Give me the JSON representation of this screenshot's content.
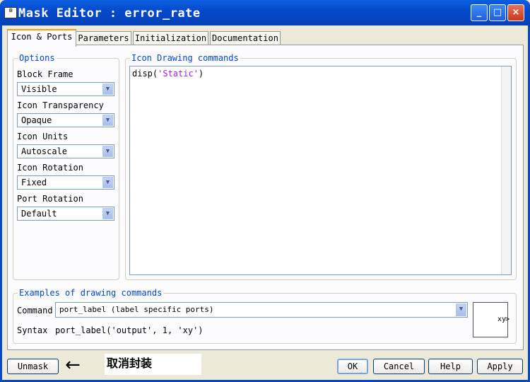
{
  "window": {
    "title": "Mask Editor : error_rate",
    "icon_text": "⊞"
  },
  "tabs": [
    {
      "label": "Icon & Ports",
      "active": true
    },
    {
      "label": "Parameters",
      "active": false
    },
    {
      "label": "Initialization",
      "active": false
    },
    {
      "label": "Documentation",
      "active": false
    }
  ],
  "options": {
    "group_label": "Options",
    "fields": [
      {
        "label": "Block Frame",
        "value": "Visible"
      },
      {
        "label": "Icon Transparency",
        "value": "Opaque"
      },
      {
        "label": "Icon Units",
        "value": "Autoscale"
      },
      {
        "label": "Icon Rotation",
        "value": "Fixed"
      },
      {
        "label": "Port Rotation",
        "value": "Default"
      }
    ]
  },
  "drawing": {
    "group_label": "Icon Drawing commands",
    "code_prefix": "disp(",
    "code_string": "'Static'",
    "code_suffix": ")"
  },
  "examples": {
    "group_label": "Examples of drawing commands",
    "command_label": "Command",
    "command_value": "port_label (label specific ports)",
    "syntax_label": "Syntax",
    "syntax_value": "port_label('output', 1, 'xy')",
    "preview_text": "xy"
  },
  "buttons": {
    "unmask": "Unmask",
    "ok": "OK",
    "cancel": "Cancel",
    "help": "Help",
    "apply": "Apply"
  },
  "annotation": {
    "arrow": "←",
    "text": "取消封装"
  }
}
